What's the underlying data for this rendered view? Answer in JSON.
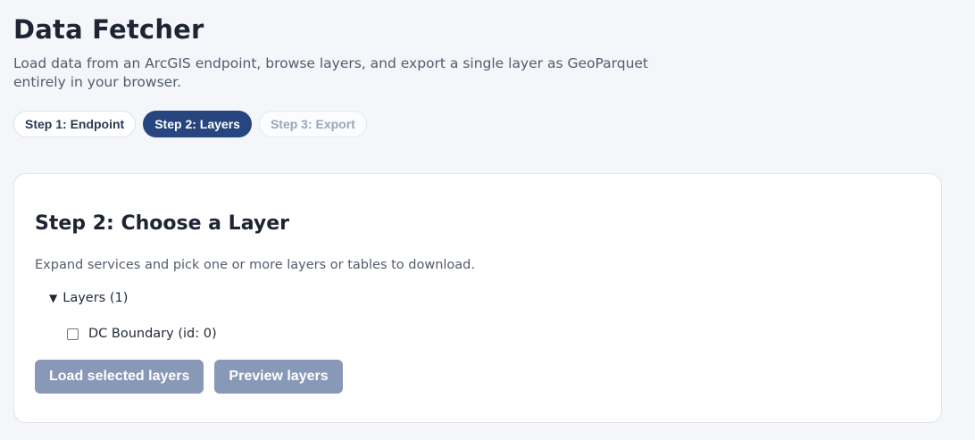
{
  "header": {
    "title": "Data Fetcher",
    "subtitle": "Load data from an ArcGIS endpoint, browse layers, and export a single layer as GeoParquet entirely in your browser."
  },
  "steps": [
    {
      "label": "Step 1: Endpoint",
      "state": "completed"
    },
    {
      "label": "Step 2: Layers",
      "state": "active"
    },
    {
      "label": "Step 3: Export",
      "state": "disabled"
    }
  ],
  "card": {
    "title": "Step 2: Choose a Layer",
    "description": "Expand services and pick one or more layers or tables to download.",
    "tree": {
      "caret": "▼",
      "summary": "Layers (1)",
      "items": [
        {
          "label": "DC Boundary (id: 0)",
          "checked": false
        }
      ]
    },
    "buttons": {
      "load_label": "Load selected layers",
      "preview_label": "Preview layers"
    }
  },
  "colors": {
    "accent": "#27467f",
    "button_disabled": "#8898b7",
    "background": "#f4f6fa"
  }
}
